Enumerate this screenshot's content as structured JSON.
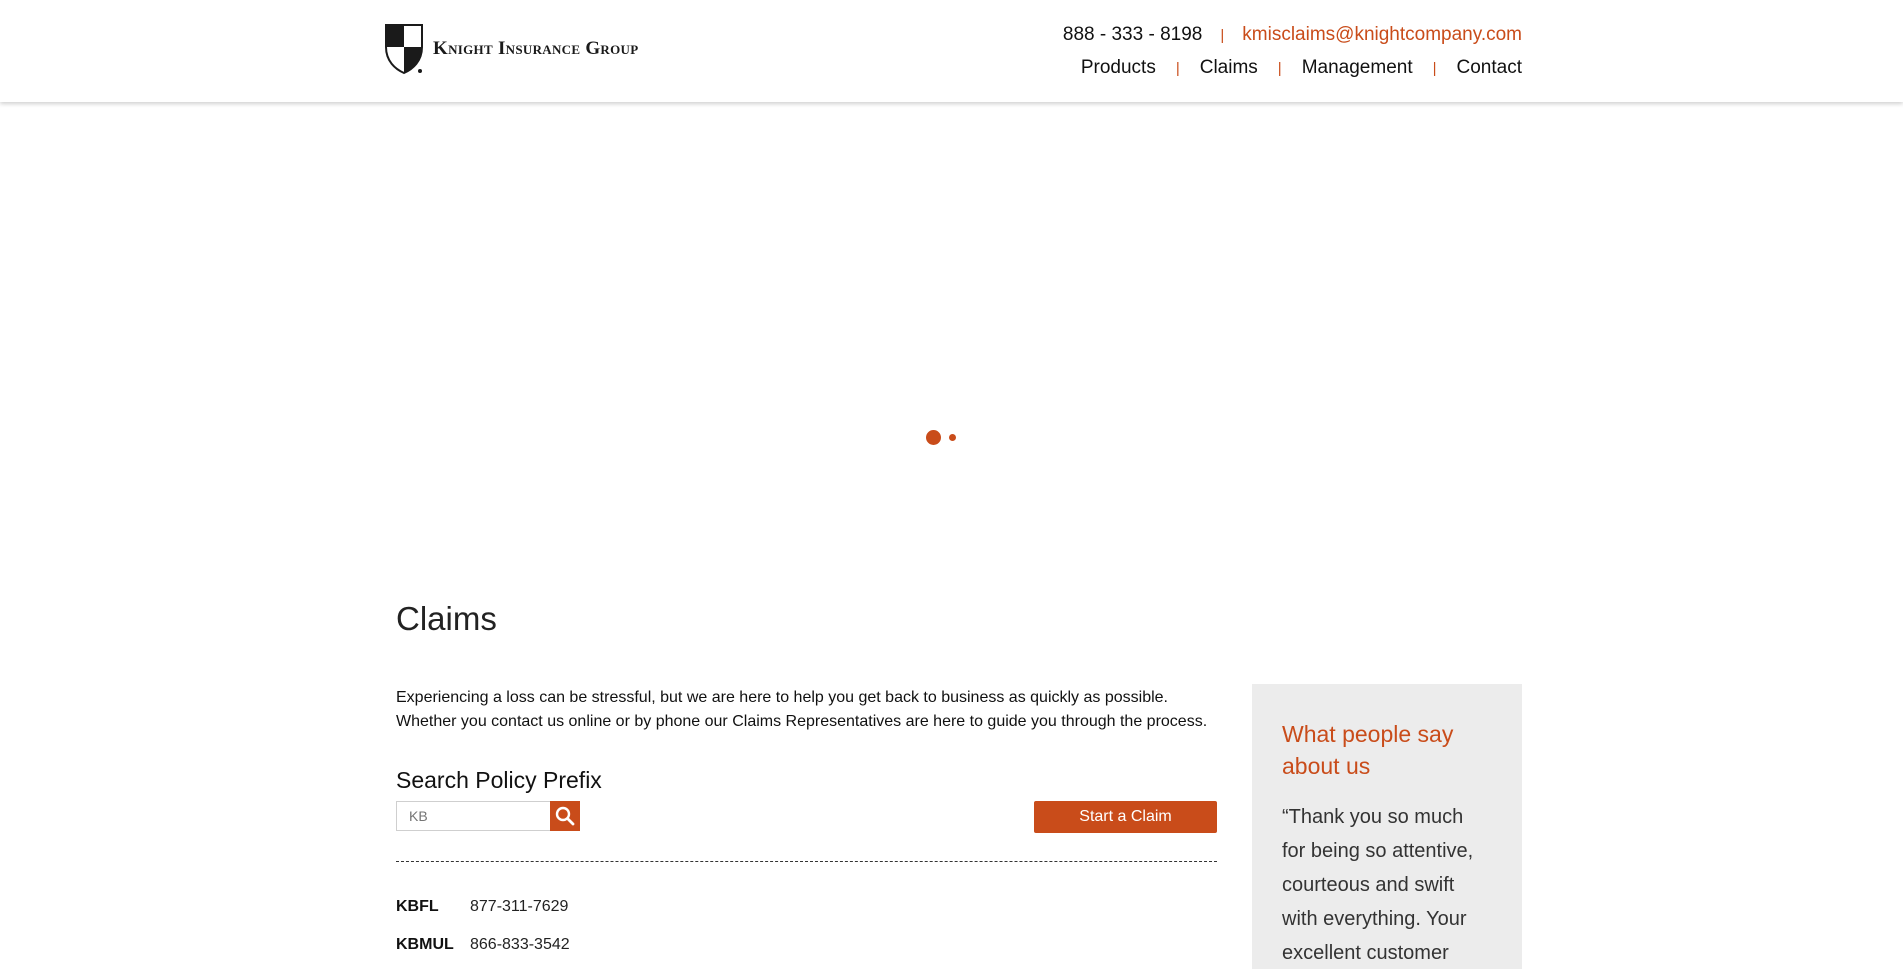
{
  "header": {
    "logo_text": "Knight Insurance Group",
    "phone": "888 - 333 - 8198",
    "contact_separator": "|",
    "email": "kmisclaims@knightcompany.com",
    "nav": [
      {
        "label": "Products"
      },
      {
        "label": "Claims"
      },
      {
        "label": "Management"
      },
      {
        "label": "Contact"
      }
    ],
    "nav_separator": "|"
  },
  "slider": {
    "indicator_icon": "loading-dots-icon"
  },
  "main": {
    "title": "Claims",
    "intro": "Experiencing a loss can be stressful, but we are here to help you get back to business as quickly as possible. Whether you contact us online or by phone our Claims Representatives are here to guide you through the process.",
    "search_title": "Search Policy Prefix",
    "search": {
      "value": "",
      "placeholder": "KB",
      "button_icon": "search-icon"
    },
    "start_claim_label": "Start a Claim",
    "prefixes": [
      {
        "code": "KBFL",
        "phone": "877-311-7629"
      },
      {
        "code": "KBMUL",
        "phone": "866-833-3542"
      }
    ]
  },
  "testimonial": {
    "title": "What people say about us",
    "quote": "“Thank you so much for being so attentive, courteous and swift with everything. Your excellent customer"
  },
  "colors": {
    "accent": "#c94c1a",
    "panel_bg": "#ececec",
    "text": "#111111"
  }
}
